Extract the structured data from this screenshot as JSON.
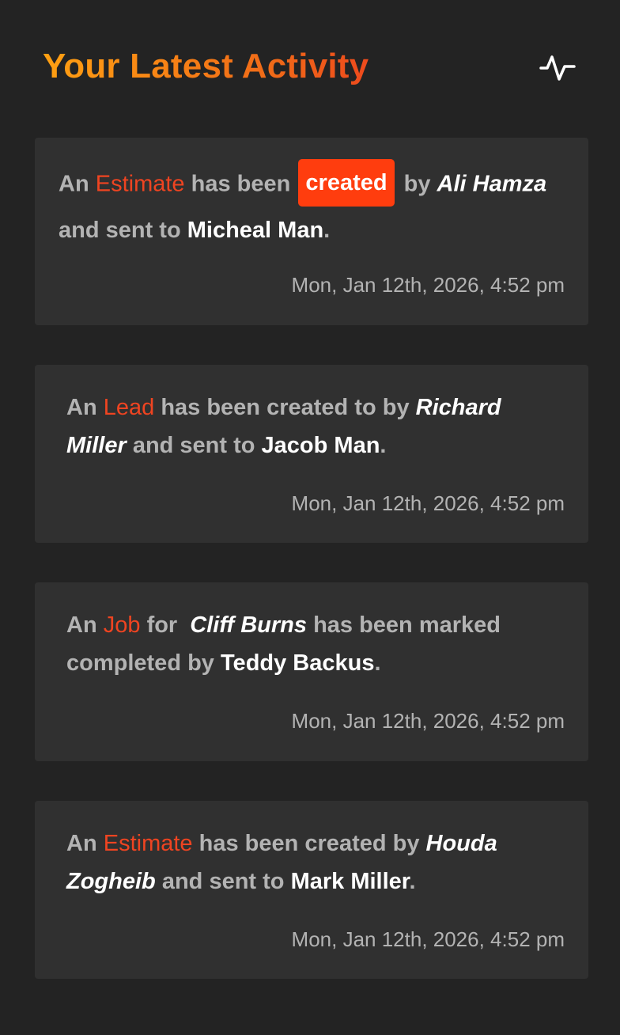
{
  "header": {
    "title": "Your Latest Activity",
    "activity_icon": "activity-pulse-icon"
  },
  "colors": {
    "background": "#232323",
    "card": "#303030",
    "accent": "#ef4421",
    "chip": "#ff3d0e",
    "title_gradient_start": "#ffa012",
    "title_gradient_end": "#ee4a1c"
  },
  "activities": [
    {
      "prefix": "An",
      "entity": "Estimate",
      "middle": "has been",
      "action_chip": "created",
      "by": "by",
      "actor": "Ali Hamza",
      "sent": "and sent to",
      "recipient": "Micheal Man",
      "end": ".",
      "timestamp": "Mon, Jan 12th, 2026, 4:52 pm"
    },
    {
      "prefix": "An",
      "entity": "Lead",
      "middle": "has been created to by",
      "actor": "Richard Miller",
      "sent": "and sent to",
      "recipient": "Jacob Man",
      "end": ".",
      "timestamp": "Mon, Jan 12th, 2026, 4:52 pm"
    },
    {
      "prefix": "An",
      "entity": "Job",
      "middle": "for",
      "actor": "Cliff Burns",
      "sent": "has been marked completed by",
      "recipient": "Teddy Backus",
      "end": ".",
      "timestamp": "Mon, Jan 12th, 2026, 4:52 pm"
    },
    {
      "prefix": "An",
      "entity": "Estimate",
      "middle": "has been created by",
      "actor": "Houda Zogheib",
      "sent": "and sent to",
      "recipient": "Mark Miller",
      "end": ".",
      "timestamp": "Mon, Jan 12th, 2026, 4:52 pm"
    }
  ]
}
